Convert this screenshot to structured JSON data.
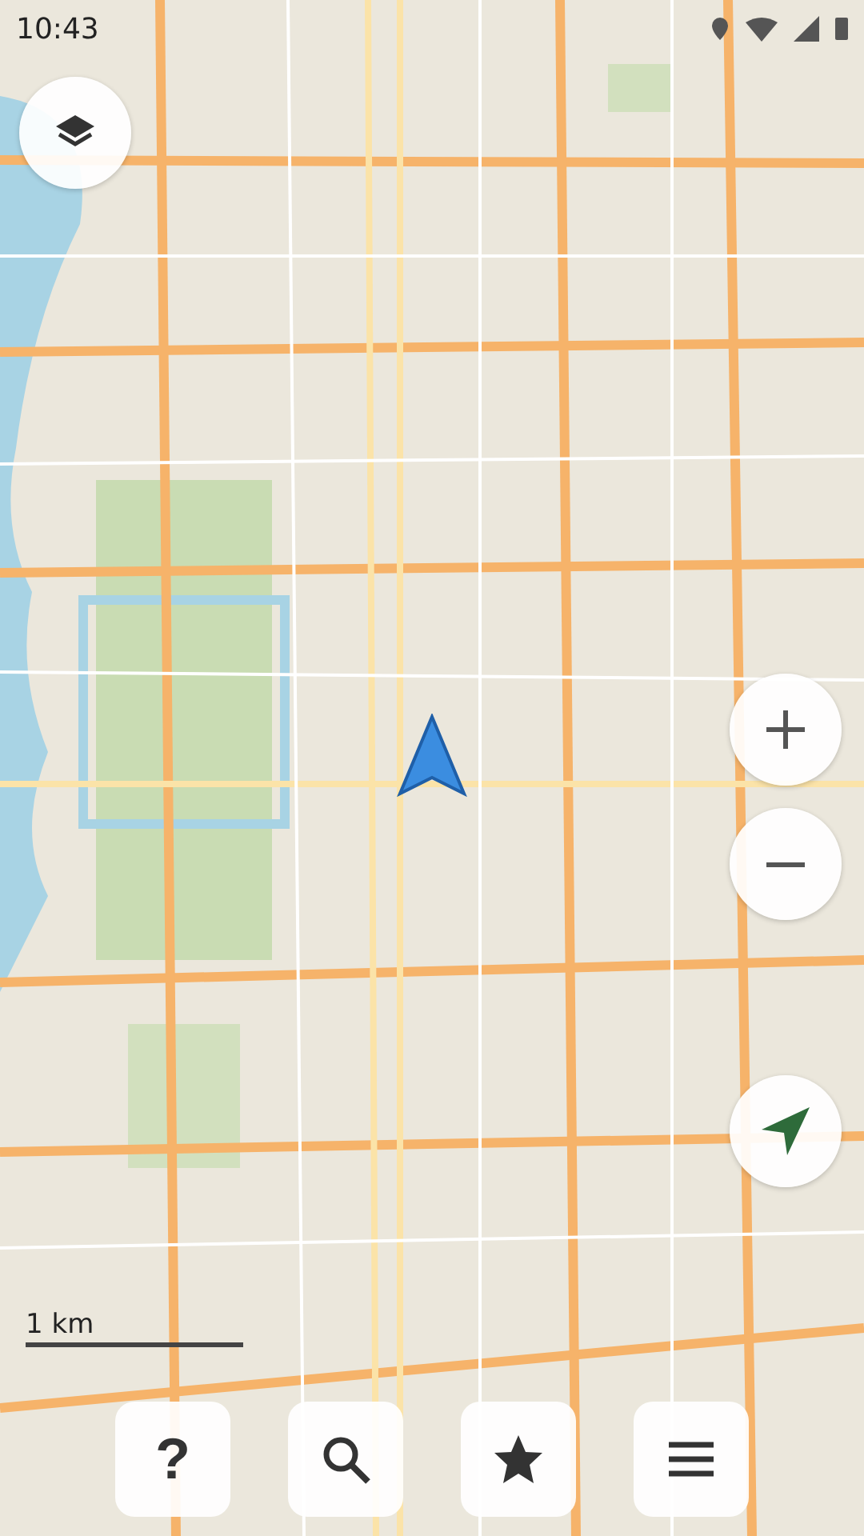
{
  "status_bar": {
    "time": "10:43"
  },
  "scale": {
    "label": "1 km"
  },
  "toolbar": [
    {
      "kind": "help",
      "label": "?"
    },
    {
      "kind": "search"
    },
    {
      "kind": "bookmarks"
    },
    {
      "kind": "menu"
    }
  ]
}
